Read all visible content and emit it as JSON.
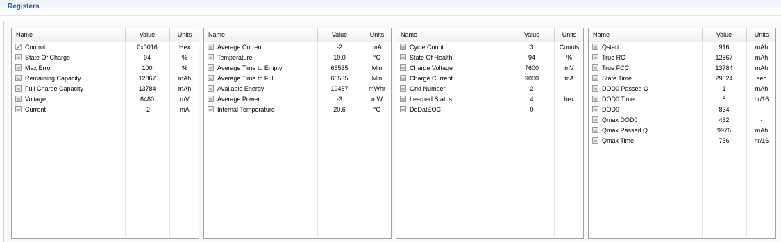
{
  "panel": {
    "title": "Registers"
  },
  "columns": {
    "name": "Name",
    "value": "Value",
    "units": "Units"
  },
  "tables": [
    {
      "rows": [
        {
          "icon": "pencil-icon",
          "name": "Control",
          "value": "0x0016",
          "units": "Hex"
        },
        {
          "icon": "lock-icon",
          "name": "State Of Charge",
          "value": "94",
          "units": "%"
        },
        {
          "icon": "lock-icon",
          "name": "Max Error",
          "value": "100",
          "units": "%"
        },
        {
          "icon": "lock-icon",
          "name": "Remaining Capacity",
          "value": "12867",
          "units": "mAh"
        },
        {
          "icon": "lock-icon",
          "name": "Full Charge Capacity",
          "value": "13784",
          "units": "mAh"
        },
        {
          "icon": "lock-icon",
          "name": "Voltage",
          "value": "6480",
          "units": "mV"
        },
        {
          "icon": "lock-icon",
          "name": "Current",
          "value": "-2",
          "units": "mA"
        }
      ]
    },
    {
      "rows": [
        {
          "icon": "lock-icon",
          "name": "Average Current",
          "value": "-2",
          "units": "mA"
        },
        {
          "icon": "lock-icon",
          "name": "Temperature",
          "value": "19.0",
          "units": "°C"
        },
        {
          "icon": "lock-icon",
          "name": "Average Time to Empty",
          "value": "65535",
          "units": "Min"
        },
        {
          "icon": "lock-icon",
          "name": "Average Time to Full",
          "value": "65535",
          "units": "Min"
        },
        {
          "icon": "lock-icon",
          "name": "Available Energy",
          "value": "19457",
          "units": "mWhr"
        },
        {
          "icon": "lock-icon",
          "name": "Average Power",
          "value": "-3",
          "units": "mW"
        },
        {
          "icon": "lock-icon",
          "name": "Internal Temperature",
          "value": "20.6",
          "units": "°C"
        }
      ]
    },
    {
      "rows": [
        {
          "icon": "lock-icon",
          "name": "Cycle Count",
          "value": "3",
          "units": "Counts"
        },
        {
          "icon": "lock-icon",
          "name": "State Of Health",
          "value": "94",
          "units": "%"
        },
        {
          "icon": "lock-icon",
          "name": "Charge Voltage",
          "value": "7600",
          "units": "mV"
        },
        {
          "icon": "lock-icon",
          "name": "Charge Current",
          "value": "9000",
          "units": "mA"
        },
        {
          "icon": "lock-icon",
          "name": "Grid Number",
          "value": "2",
          "units": "-"
        },
        {
          "icon": "lock-icon",
          "name": "Learned Status",
          "value": "4",
          "units": "hex"
        },
        {
          "icon": "lock-icon",
          "name": "DoDatEOC",
          "value": "0",
          "units": "-"
        }
      ]
    },
    {
      "rows": [
        {
          "icon": "lock-icon",
          "name": "Qstart",
          "value": "916",
          "units": "mAh"
        },
        {
          "icon": "lock-icon",
          "name": "True RC",
          "value": "12867",
          "units": "mAh"
        },
        {
          "icon": "lock-icon",
          "name": "True FCC",
          "value": "13784",
          "units": "mAh"
        },
        {
          "icon": "lock-icon",
          "name": "State Time",
          "value": "29024",
          "units": "sec"
        },
        {
          "icon": "lock-icon",
          "name": "DOD0 Passed Q",
          "value": "1",
          "units": "mAh"
        },
        {
          "icon": "lock-icon",
          "name": "DOD0 Time",
          "value": "8",
          "units": "hr/16"
        },
        {
          "icon": "lock-icon",
          "name": "DOD0",
          "value": "834",
          "units": "-"
        },
        {
          "icon": "lock-icon",
          "name": "Qmax DOD0",
          "value": "432",
          "units": "-"
        },
        {
          "icon": "lock-icon",
          "name": "Qmax Passed Q",
          "value": "9976",
          "units": "mAh"
        },
        {
          "icon": "lock-icon",
          "name": "Qmax Time",
          "value": "756",
          "units": "hr/16"
        }
      ]
    }
  ]
}
